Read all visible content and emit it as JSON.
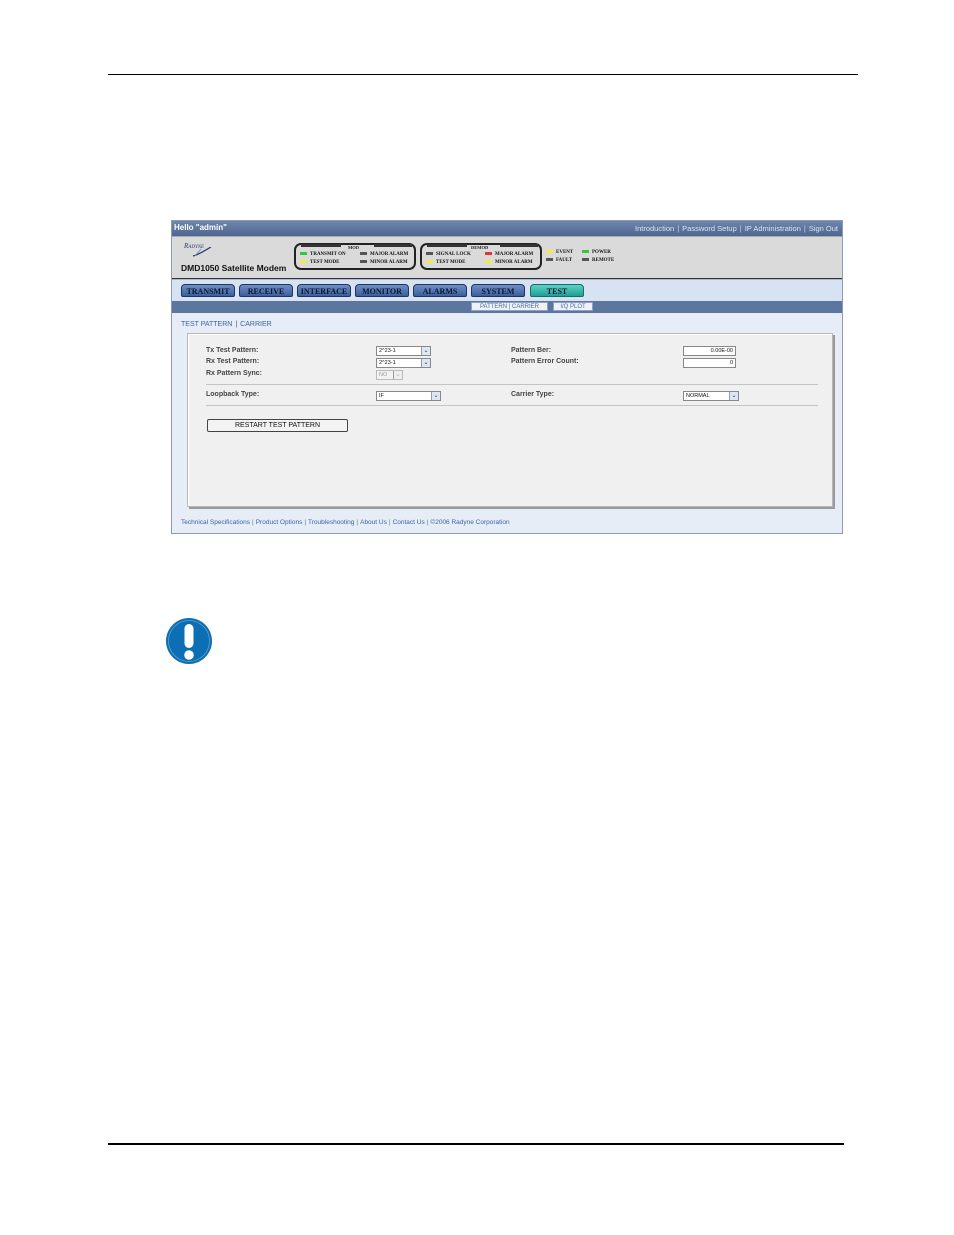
{
  "topbar": {
    "greeting": "Hello \"admin\"",
    "links": [
      "Introduction",
      "Password Setup",
      "IP Administration",
      "Sign Out"
    ]
  },
  "header": {
    "brand": "Radyne",
    "product": "DMD1050 Satellite Modem",
    "mod_group": {
      "title": "MOD",
      "indicators": [
        {
          "label": "TRANSMIT ON",
          "color": "#35c935"
        },
        {
          "label": "MAJOR ALARM",
          "color": "#555555"
        },
        {
          "label": "TEST MODE",
          "color": "#f2e94a"
        },
        {
          "label": "MINOR ALARM",
          "color": "#555555"
        }
      ]
    },
    "demod_group": {
      "title": "DEMOD",
      "indicators": [
        {
          "label": "SIGNAL LOCK",
          "color": "#555555"
        },
        {
          "label": "MAJOR ALARM",
          "color": "#e2343a"
        },
        {
          "label": "TEST MODE",
          "color": "#f2e94a"
        },
        {
          "label": "MINOR ALARM",
          "color": "#f2e94a"
        }
      ]
    },
    "status": [
      {
        "label": "EVENT",
        "color": "#f2e94a"
      },
      {
        "label": "POWER",
        "color": "#35c935"
      },
      {
        "label": "FAULT",
        "color": "#555555"
      },
      {
        "label": "REMOTE",
        "color": "#555555"
      }
    ]
  },
  "tabs": [
    "TRANSMIT",
    "RECEIVE",
    "INTERFACE",
    "MONITOR",
    "ALARMS",
    "SYSTEM",
    "TEST"
  ],
  "active_tab": "TEST",
  "subtabs": [
    "PATTERN | CARRIER",
    "I/Q PLOT"
  ],
  "breadcrumb": [
    "TEST PATTERN",
    "CARRIER"
  ],
  "form": {
    "tx_test_pattern": {
      "label": "Tx Test Pattern:",
      "value": "2^23-1"
    },
    "rx_test_pattern": {
      "label": "Rx Test Pattern:",
      "value": "2^23-1"
    },
    "rx_pattern_sync": {
      "label": "Rx Pattern Sync:",
      "value": "NO"
    },
    "pattern_ber": {
      "label": "Pattern Ber:",
      "value": "0.00E-00"
    },
    "pattern_error_count": {
      "label": "Pattern Error Count:",
      "value": "0"
    },
    "loopback_type": {
      "label": "Loopback Type:",
      "value": "IF"
    },
    "carrier_type": {
      "label": "Carrier Type:",
      "value": "NORMAL"
    },
    "restart_button": "RESTART TEST PATTERN"
  },
  "footer": {
    "links": [
      "Technical Specifications",
      "Product Options",
      "Troubleshooting",
      "About Us",
      "Contact Us"
    ],
    "copyright": "©2006 Radyne Corporation"
  },
  "colors": {
    "topbar": "#5a729c",
    "active_tab": "#1e9e93",
    "note_icon": "#0c6fb3"
  }
}
